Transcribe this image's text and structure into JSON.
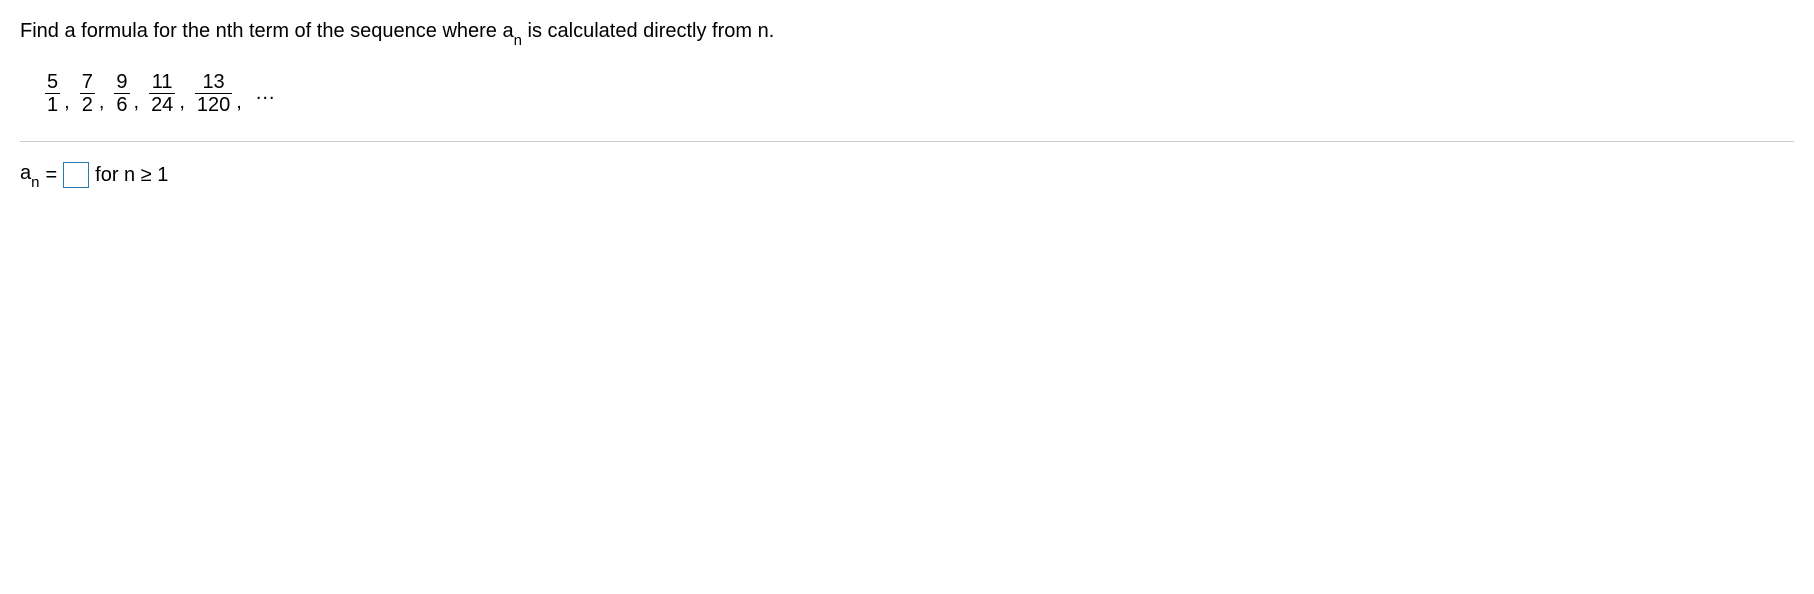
{
  "question": {
    "prefix": "Find a formula for the nth term of the sequence where ",
    "var": "a",
    "sub": "n",
    "suffix": " is calculated directly from n."
  },
  "sequence": [
    {
      "num": "5",
      "den": "1"
    },
    {
      "num": "7",
      "den": "2"
    },
    {
      "num": "9",
      "den": "6"
    },
    {
      "num": "11",
      "den": "24"
    },
    {
      "num": "13",
      "den": "120"
    }
  ],
  "ellipsis": "...",
  "answer": {
    "var": "a",
    "sub": "n",
    "equals": "=",
    "value": "",
    "for_text": "for n ≥ 1"
  }
}
